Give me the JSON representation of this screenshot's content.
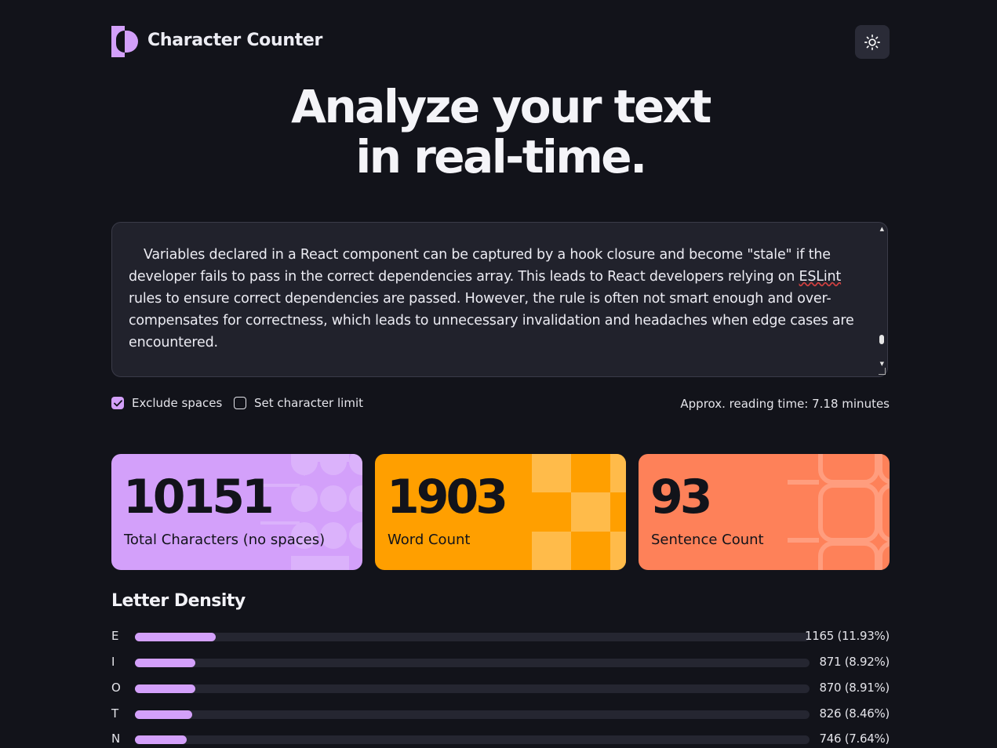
{
  "header": {
    "app_title": "Character Counter",
    "theme_toggle_icon": "sun-icon"
  },
  "hero": {
    "line1": "Analyze your text",
    "line2": "in real-time."
  },
  "editor": {
    "text_before": "Variables declared in a React component can be captured by a hook closure and become \"stale\" if the developer fails to pass in the correct dependencies array. This leads to React developers relying on ",
    "text_squiggle": "ESLint",
    "text_after": " rules to ensure correct dependencies are passed. However, the rule is often not smart enough and over-compensates for correctness, which leads to unnecessary invalidation and headaches when edge cases are encountered."
  },
  "options": {
    "exclude_spaces_label": "Exclude spaces",
    "exclude_spaces_checked": true,
    "char_limit_label": "Set character limit",
    "char_limit_checked": false,
    "reading_time": "Approx. reading time: 7.18 minutes"
  },
  "stats": [
    {
      "value": "10151",
      "label": "Total Characters (no spaces)",
      "color": "#d3a0fa"
    },
    {
      "value": "1903",
      "label": "Word Count",
      "color": "#ff9f00"
    },
    {
      "value": "93",
      "label": "Sentence Count",
      "color": "#fe8159"
    }
  ],
  "letter_density": {
    "title": "Letter Density",
    "rows": [
      {
        "letter": "E",
        "value": "1165 (11.93%)",
        "fraction": 0.1193
      },
      {
        "letter": "I",
        "value": "871 (8.92%)",
        "fraction": 0.0892
      },
      {
        "letter": "O",
        "value": "870 (8.91%)",
        "fraction": 0.0891
      },
      {
        "letter": "T",
        "value": "826 (8.46%)",
        "fraction": 0.0846
      },
      {
        "letter": "N",
        "value": "746 (7.64%)",
        "fraction": 0.0764
      }
    ]
  }
}
